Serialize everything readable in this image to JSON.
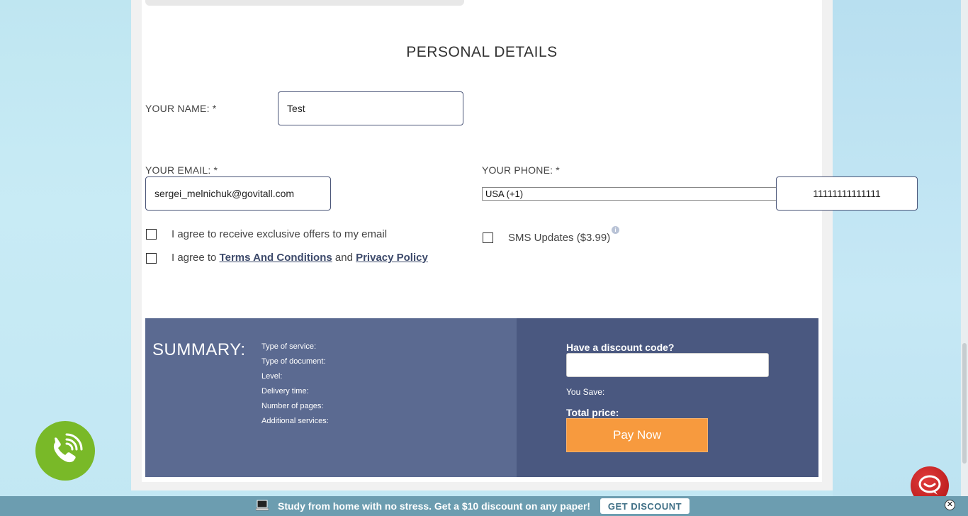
{
  "section_title": "PERSONAL DETAILS",
  "name": {
    "label": "YOUR NAME: *",
    "value": "Test"
  },
  "email": {
    "label": "YOUR EMAIL: *",
    "value": "sergei_melnichuk@govitall.com"
  },
  "phone": {
    "label": "YOUR PHONE: *",
    "country": "USA (+1)",
    "value": "11111111111111"
  },
  "checkboxes": {
    "offers": "I agree to receive exclusive offers to my email",
    "terms_prefix": "I agree to ",
    "terms_link": "Terms And Conditions",
    "terms_and": " and ",
    "privacy_link": "Privacy Policy",
    "sms": "SMS Updates ($3.99)"
  },
  "summary": {
    "title": "SUMMARY:",
    "items": [
      "Type of service:",
      "Type of document:",
      "Level:",
      "Delivery time:",
      "Number of pages:",
      "Additional services:"
    ],
    "discount_label": "Have a discount code?",
    "you_save": "You Save:",
    "total_price": "Total price:",
    "pay_button": "Pay Now"
  },
  "banner": {
    "text": "Study from home with no stress. Get a $10 discount on any paper!",
    "button": "GET DISCOUNT"
  },
  "icons": {
    "phone": "phone-icon",
    "chat": "chat-icon",
    "close": "close-icon",
    "info": "info-icon",
    "laptop": "laptop-icon"
  },
  "colors": {
    "summary_left": "#5b6a91",
    "summary_right": "#4a5880",
    "pay_button": "#f79a3e",
    "phone_button": "#79b928",
    "chat_button": "#c41e1e",
    "banner": "#6c9db0"
  }
}
